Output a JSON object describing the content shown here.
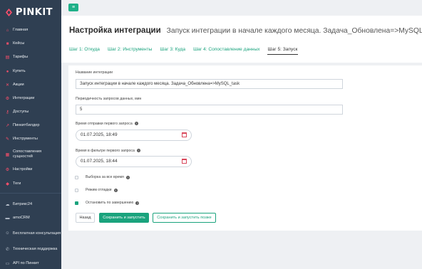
{
  "brand": {
    "name": "PINKIT",
    "accent": "#ff4f6b",
    "green": "#1aa37d"
  },
  "sidebar": {
    "items": [
      {
        "label": "Главная",
        "icon": "home-icon"
      },
      {
        "label": "Кейсы",
        "icon": "briefcase-icon"
      },
      {
        "label": "Тарифы",
        "icon": "tariff-icon"
      },
      {
        "label": "Купить",
        "icon": "cart-icon"
      },
      {
        "label": "Акции",
        "icon": "sale-icon"
      },
      {
        "label": "Интеграции",
        "icon": "integration-icon"
      },
      {
        "label": "Доступы",
        "icon": "key-icon"
      },
      {
        "label": "Пинкитбилдер",
        "icon": "builder-icon"
      },
      {
        "label": "Инструменты",
        "icon": "tools-icon"
      },
      {
        "label": "Сопоставления сущностей",
        "icon": "grid-icon"
      },
      {
        "label": "Настройки",
        "icon": "gear-icon"
      },
      {
        "label": "Теги",
        "icon": "tag-icon"
      }
    ],
    "bottom_items": [
      {
        "label": "Битрикс24",
        "icon": "cloud-icon"
      },
      {
        "label": "amoCRM",
        "icon": "amocrm-icon"
      },
      {
        "label": "Бесплатная консультация",
        "icon": "user-icon"
      },
      {
        "label": "Техническая поддержка",
        "icon": "support-icon"
      },
      {
        "label": "API по Пинкит",
        "icon": "api-icon"
      }
    ]
  },
  "header": {
    "title": "Настройка интеграции",
    "subtitle": "Запуск интеграции в начале каждого месяца. Задача_Обновлена=>MySQL_task"
  },
  "tabs": [
    {
      "label": "Шаг 1: Откуда",
      "active": false
    },
    {
      "label": "Шаг 2: Инструменты",
      "active": false
    },
    {
      "label": "Шаг 3: Куда",
      "active": false
    },
    {
      "label": "Шаг 4: Сопоставление данных",
      "active": false
    },
    {
      "label": "Шаг 5: Запуск",
      "active": true
    }
  ],
  "form": {
    "name_label": "Название интеграции",
    "name_value": "Запуск интеграции в начале каждого месяца. Задача_Обновлена=>MySQL_task",
    "period_label": "Периодичность запросов данных, мин",
    "period_value": "5",
    "first_send_label": "Время отправки первого запроса",
    "first_send_value": "01.07.2025, 18:49",
    "filter_label": "Время в фильтре первого запроса",
    "filter_value": "01.07.2025, 18:44",
    "checkboxes": [
      {
        "label": "Выборка за все время",
        "checked": false,
        "help": true
      },
      {
        "label": "Режим отладки",
        "checked": false,
        "help": true
      },
      {
        "label": "Остановить по завершению",
        "checked": true,
        "help": true
      }
    ],
    "help_glyph": "?",
    "buttons": {
      "back": "Назад",
      "save_run": "Сохранить и запустить",
      "save_run_later": "Сохранить и запустить позже"
    }
  }
}
